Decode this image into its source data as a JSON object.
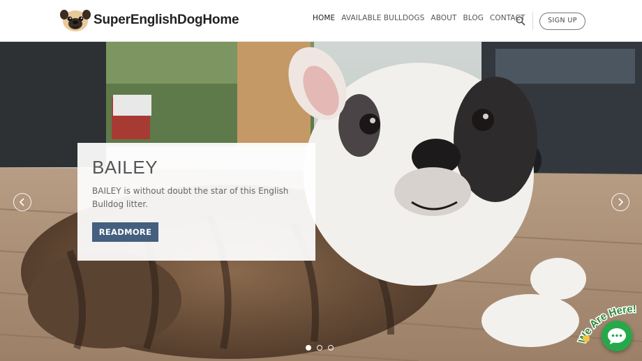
{
  "brand": {
    "name": "SuperEnglishDogHome",
    "logo_icon": "pug-face-icon"
  },
  "nav": {
    "items": [
      {
        "label": "HOME",
        "active": true
      },
      {
        "label": "AVAILABLE BULLDOGS",
        "active": false
      },
      {
        "label": "ABOUT",
        "active": false
      },
      {
        "label": "BLOG",
        "active": false
      },
      {
        "label": "CONTACT",
        "active": false
      }
    ],
    "search_icon": "search-icon",
    "signup_label": "SIGN UP"
  },
  "slider": {
    "slide_title": "BAILEY",
    "slide_text": "BAILEY is without doubt the star of this English Bulldog litter.",
    "button_label": "READMORE",
    "prev_icon": "chevron-left-icon",
    "next_icon": "chevron-right-icon",
    "dots": {
      "count": 3,
      "active_index": 0
    }
  },
  "chat": {
    "badge_text": "We Are Here!",
    "icon": "chat-bubble-icon",
    "color": "#26a94b"
  },
  "colors": {
    "button": "#445f7f",
    "text_dark": "#222222",
    "chat_green": "#26a94b"
  }
}
